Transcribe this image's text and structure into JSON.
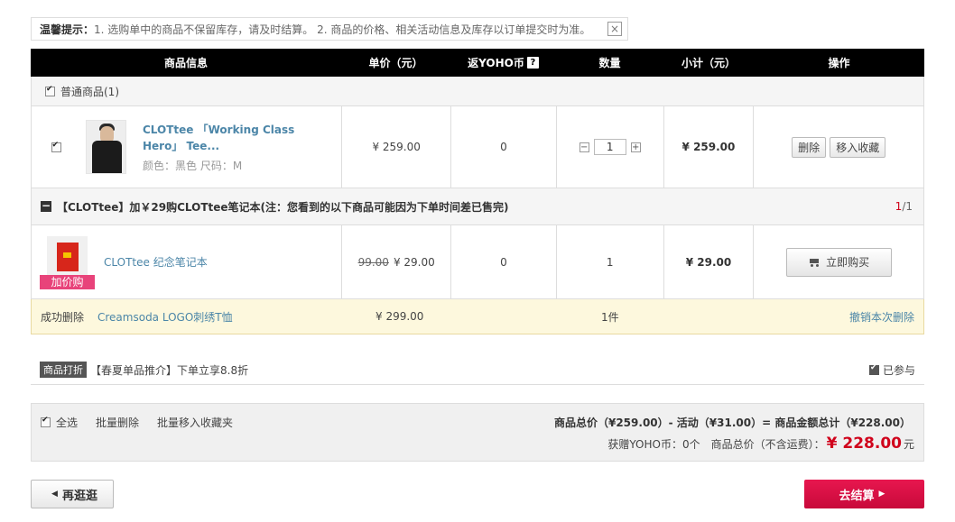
{
  "tip": {
    "title": "温馨提示：",
    "text": "1. 选购单中的商品不保留库存，请及时结算。 2. 商品的价格、相关活动信息及库存以订单提交时为准。",
    "close_icon": "×"
  },
  "table_header": {
    "info": "商品信息",
    "price": "单价（元）",
    "yoho": "返YOHO币",
    "yoho_help": "?",
    "qty": "数量",
    "subtotal": "小计（元）",
    "ops": "操作"
  },
  "group": {
    "label": "普通商品(1)"
  },
  "item": {
    "name": "CLOTtee 「Working Class Hero」 Tee...",
    "attrs": "颜色：黑色 尺码：M",
    "price": "¥ 259.00",
    "yoho": "0",
    "qty": "1",
    "subtotal": "¥ 259.00",
    "delete_label": "删除",
    "fav_label": "移入收藏",
    "qty_minus": "−",
    "qty_plus": "+"
  },
  "promo": {
    "title": "【CLOTtee】加￥29购CLOTtee笔记本(注：您看到的以下商品可能因为下单时间差已售完)",
    "page_current": "1",
    "page_total": "/1",
    "collapse_icon": "−"
  },
  "promo_item": {
    "tag": "加价购",
    "name": "CLOTtee 纪念笔记本",
    "orig_price": "99.00",
    "price": "¥ 29.00",
    "yoho": "0",
    "qty": "1",
    "subtotal": "¥ 29.00",
    "buy_label": "立即购买"
  },
  "removed": {
    "label": "成功删除",
    "name": "Creamsoda LOGO刺绣T恤",
    "price": "¥ 299.00",
    "qty": "1件",
    "undo": "撤销本次删除"
  },
  "discount": {
    "badge": "商品打折",
    "text": "【春夏单品推介】下单立享8.8折",
    "joined": "已参与"
  },
  "footer": {
    "select_all": "全选",
    "batch_delete": "批量删除",
    "batch_fav": "批量移入收藏夹",
    "summary": "商品总价（¥259.00）- 活动（¥31.00）= 商品金额总计（¥228.00）",
    "yoho_earn": "获赠YOHO币：0个",
    "total_label": "商品总价（不含运费）：",
    "total_amount": "¥ 228.00",
    "total_unit": "元"
  },
  "actions": {
    "back_label": "再逛逛",
    "checkout_label": "去结算"
  }
}
